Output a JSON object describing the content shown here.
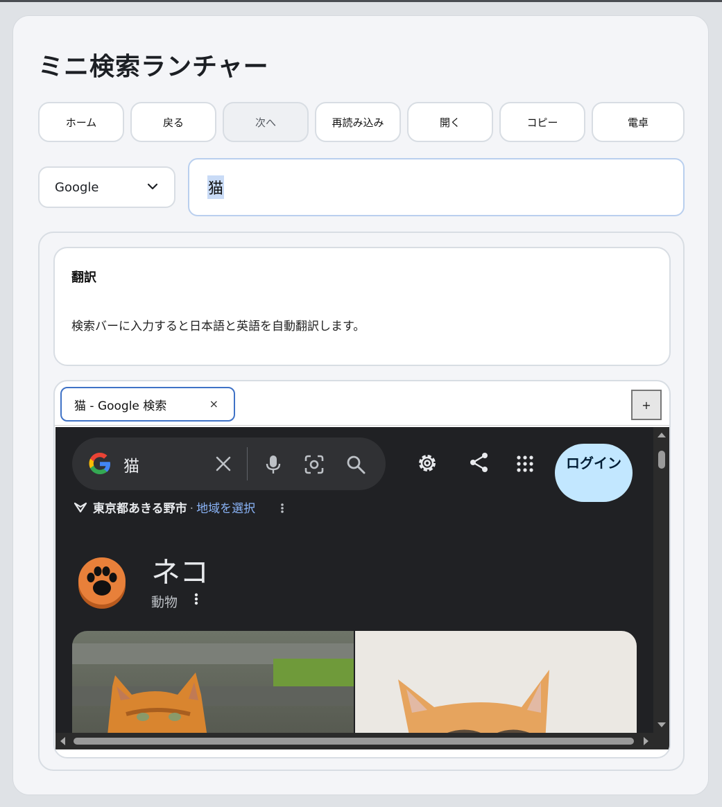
{
  "app": {
    "title": "ミニ検索ランチャー"
  },
  "toolbar": {
    "buttons": [
      {
        "label": "ホーム",
        "enabled": true
      },
      {
        "label": "戻る",
        "enabled": true
      },
      {
        "label": "次へ",
        "enabled": false
      },
      {
        "label": "再読み込み",
        "enabled": true
      },
      {
        "label": "開く",
        "enabled": true
      },
      {
        "label": "コピー",
        "enabled": true
      },
      {
        "label": "電卓",
        "enabled": true
      }
    ]
  },
  "search": {
    "engine": "Google",
    "query": "猫"
  },
  "translation": {
    "heading": "翻訳",
    "description": "検索バーに入力すると日本語と英語を自動翻訳します。"
  },
  "browser": {
    "tabs": [
      {
        "title": "猫 - Google 検索",
        "close": "×",
        "active": true
      }
    ],
    "new_tab": "+",
    "page": {
      "query": "猫",
      "login": "ログイン",
      "location": "東京都あきる野市",
      "location_separator": "·",
      "location_select": "地域を選択",
      "entity_title": "ネコ",
      "entity_type": "動物"
    }
  },
  "colors": {
    "accent": "#3f72c6",
    "search_border": "#b9cfee",
    "selection": "#c9dbf6",
    "google_bg": "#202124",
    "login_bg": "#c2e7ff"
  }
}
